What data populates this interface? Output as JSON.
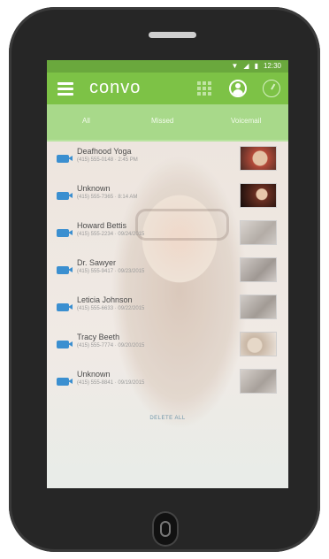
{
  "status_bar": {
    "icons": [
      "signal-icon",
      "wifi-icon",
      "battery-icon"
    ],
    "time": "12:30"
  },
  "app_bar": {
    "title": "convo"
  },
  "tabs": [
    {
      "label": "All"
    },
    {
      "label": "Missed"
    },
    {
      "label": "Voicemail"
    }
  ],
  "calls": [
    {
      "name": "Deafhood Yoga",
      "sub": "(415) 555-0148 · 2:45 PM"
    },
    {
      "name": "Unknown",
      "sub": "(415) 555-7365 · 8:14 AM"
    },
    {
      "name": "Howard Bettis",
      "sub": "(415) 555-2234 · 09/24/2015"
    },
    {
      "name": "Dr. Sawyer",
      "sub": "(415) 555-9417 · 09/23/2015"
    },
    {
      "name": "Leticia Johnson",
      "sub": "(415) 555-6633 · 09/22/2015"
    },
    {
      "name": "Tracy Beeth",
      "sub": "(415) 555-7774 · 09/20/2015"
    },
    {
      "name": "Unknown",
      "sub": "(415) 555-8841 · 09/19/2015"
    }
  ],
  "delete_all_label": "DELETE ALL",
  "colors": {
    "status_bar": "#6aa83d",
    "app_bar": "#7dc246",
    "tabs": "#a8d98a",
    "camera": "#3b8fd0"
  }
}
